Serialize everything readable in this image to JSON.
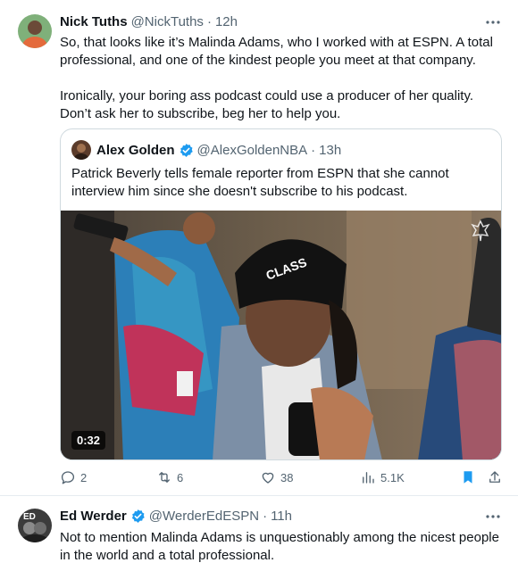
{
  "tweet1": {
    "author_name": "Nick Tuths",
    "handle": "@NickTuths",
    "separator": "·",
    "time": "12h",
    "more_icon": "more-horizontal-icon",
    "text_p1": "So, that looks like it’s Malinda Adams, who I worked with at ESPN. A total professional, and one of the kindest people you meet at that company.",
    "text_p2": "Ironically, your boring ass podcast could use a producer of her quality. Don’t ask her to subscribe, beg her to help you.",
    "quote": {
      "author_name": "Alex Golden",
      "verified": true,
      "handle": "@AlexGoldenNBA",
      "separator": "·",
      "time": "13h",
      "text": "Patrick Beverly tells female reporter from ESPN that she cannot interview him since she doesn't subscribe to his podcast.",
      "video_duration": "0:32"
    },
    "actions": {
      "replies": "2",
      "reposts": "6",
      "likes": "38",
      "views": "5.1K"
    },
    "colors": {
      "bookmark_active": "#1d9bf0",
      "verified": "#1d9bf0",
      "muted": "#536471"
    }
  },
  "tweet2": {
    "author_name": "Ed Werder",
    "verified": true,
    "handle": "@WerderEdESPN",
    "separator": "·",
    "time": "11h",
    "avatar_text": "ED",
    "text": "Not to mention Malinda Adams is unquestionably among the nicest people in the world and a total professional."
  }
}
